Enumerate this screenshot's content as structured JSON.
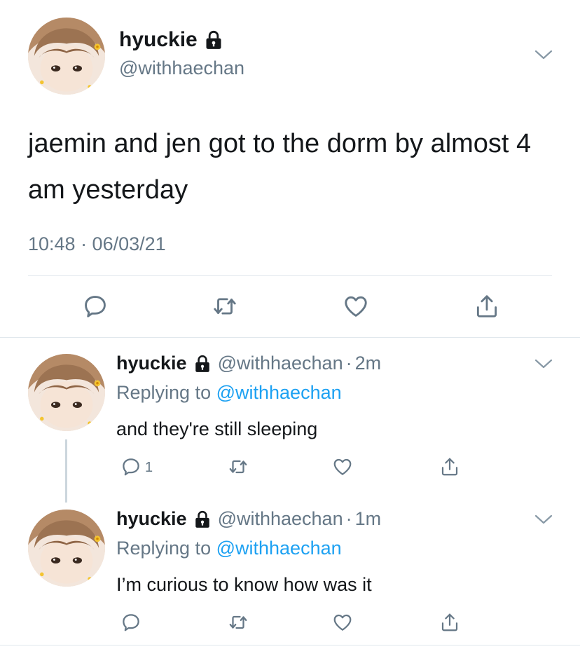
{
  "main_tweet": {
    "name": "hyuckie",
    "handle": "@withhaechan",
    "text": "jaemin and jen got to the dorm by almost 4 am yesterday",
    "timestamp": "10:48 · 06/03/21",
    "avatar_icon": "profile-photo",
    "actions": [
      "reply-icon",
      "retweet-icon",
      "like-icon",
      "share-icon"
    ]
  },
  "replies": [
    {
      "name": "hyuckie",
      "handle": "@withhaechan",
      "separator": "·",
      "time": "2m",
      "replying_prefix": "Replying to ",
      "replying_to": "@withhaechan",
      "text": "and they're still sleeping",
      "reply_count": "1"
    },
    {
      "name": "hyuckie",
      "handle": "@withhaechan",
      "separator": "·",
      "time": "1m",
      "replying_prefix": "Replying to ",
      "replying_to": "@withhaechan",
      "text": "I’m curious to know how was it",
      "reply_count": ""
    }
  ],
  "colors": {
    "text": "#14171a",
    "secondary": "#657786",
    "link": "#1da1f2",
    "divider": "#e1e8ed",
    "thread_line": "#ccd6dd"
  }
}
